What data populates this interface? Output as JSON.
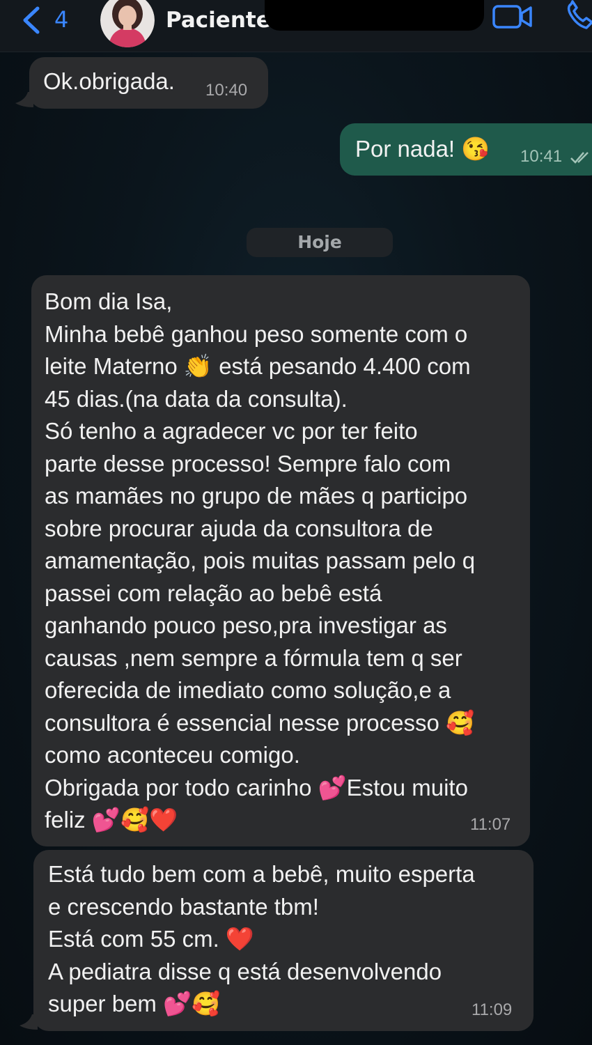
{
  "header": {
    "back_count": "4",
    "contact_name": "Paciente"
  },
  "messages": [
    {
      "id": "m1",
      "direction": "in",
      "text": "Ok.obrigada.",
      "time": "10:40"
    },
    {
      "id": "m2",
      "direction": "out",
      "text": "Por nada! 😘",
      "time": "10:41"
    },
    {
      "id": "m3",
      "direction": "in",
      "time": "11:07",
      "lines": [
        "Bom dia Isa,",
        "Minha bebê ganhou peso somente com o",
        "leite Materno 👏 está pesando 4.400 com",
        "45 dias.(na data da consulta).",
        "Só tenho a agradecer vc por ter feito",
        "parte desse processo! Sempre falo com",
        "as mamães no grupo de mães q participo",
        "sobre procurar ajuda da consultora de",
        "amamentação, pois muitas passam pelo q",
        "passei com relação ao bebê está",
        "ganhando pouco peso,pra investigar as",
        "causas ,nem sempre a fórmula tem q ser",
        "oferecida de imediato como solução,e a",
        "consultora é essencial nesse processo 🥰",
        "como aconteceu comigo.",
        "Obrigada por todo carinho 💕Estou muito",
        "feliz 💕🥰❤️"
      ]
    },
    {
      "id": "m4",
      "direction": "in",
      "time": "11:09",
      "lines": [
        "Está tudo bem com a bebê, muito esperta",
        "e crescendo bastante tbm!",
        "Está com 55 cm. ❤️",
        "A pediatra disse q está desenvolvendo",
        "super bem 💕🥰"
      ]
    }
  ],
  "date_separator": "Hoje",
  "colors": {
    "incoming_bubble": "#2b2c2e",
    "outgoing_bubble": "#1f5a4b",
    "accent": "#3a86ff"
  }
}
